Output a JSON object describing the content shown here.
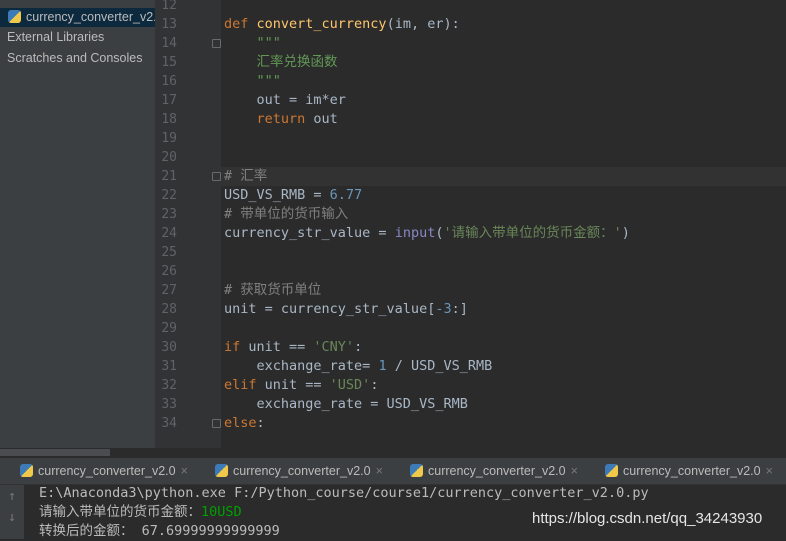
{
  "sidebar": {
    "items": [
      {
        "label": "currency_converter_v2.",
        "icon": "python-file-icon",
        "selected": true
      },
      {
        "label": "External Libraries",
        "icon": "library-icon"
      },
      {
        "label": "Scratches and Consoles",
        "icon": "scratches-icon"
      }
    ]
  },
  "editor": {
    "first_line": 12,
    "current_line": 21,
    "lines": [
      [],
      [
        [
          "def ",
          "kw"
        ],
        [
          "convert_currency",
          "fn"
        ],
        [
          "(im, er):",
          ""
        ]
      ],
      [
        [
          "    \"\"\"",
          "doc"
        ]
      ],
      [
        [
          "    汇率兑换函数",
          "doc"
        ]
      ],
      [
        [
          "    \"\"\"",
          "doc"
        ]
      ],
      [
        [
          "    out = im*er",
          ""
        ]
      ],
      [
        [
          "    ",
          ""
        ],
        [
          "return ",
          "kw"
        ],
        [
          "out",
          ""
        ]
      ],
      [],
      [],
      [
        [
          "# 汇率",
          "cm"
        ]
      ],
      [
        [
          "USD_VS_RMB = ",
          ""
        ],
        [
          "6.77",
          "num"
        ]
      ],
      [
        [
          "# 带单位的货币输入",
          "cm"
        ]
      ],
      [
        [
          "currency_str_value = ",
          ""
        ],
        [
          "input",
          "bi"
        ],
        [
          "(",
          ""
        ],
        [
          "'请输入带单位的货币金额：'",
          "str"
        ],
        [
          ")",
          ""
        ]
      ],
      [],
      [],
      [
        [
          "# 获取货币单位",
          "cm"
        ]
      ],
      [
        [
          "unit = currency_str_value[",
          ""
        ],
        [
          "-3",
          "num"
        ],
        [
          ":]",
          ""
        ]
      ],
      [],
      [
        [
          "if ",
          "kw"
        ],
        [
          "unit == ",
          ""
        ],
        [
          "'CNY'",
          "str"
        ],
        [
          ":",
          ""
        ]
      ],
      [
        [
          "    exchange_rate= ",
          ""
        ],
        [
          "1",
          "num"
        ],
        [
          " / USD_VS_RMB",
          ""
        ]
      ],
      [
        [
          "elif ",
          "kw"
        ],
        [
          "unit == ",
          ""
        ],
        [
          "'USD'",
          "str"
        ],
        [
          ":",
          ""
        ]
      ],
      [
        [
          "    exchange_rate = USD_VS_RMB",
          ""
        ]
      ],
      [
        [
          "else",
          "kw"
        ],
        [
          ":",
          ""
        ]
      ]
    ]
  },
  "tabs": [
    {
      "label": "currency_converter_v2.0"
    },
    {
      "label": "currency_converter_v2.0"
    },
    {
      "label": "currency_converter_v2.0"
    },
    {
      "label": "currency_converter_v2.0"
    }
  ],
  "tab_close": "×",
  "console": {
    "command": "E:\\Anaconda3\\python.exe F:/Python_course/course1/currency_converter_v2.0.py",
    "prompt": "请输入带单位的货币金额：",
    "input_value": "10USD",
    "result": "转换后的金额： 67.69999999999999",
    "up_arrow": "↑",
    "down_arrow": "↓"
  },
  "watermark": "https://blog.csdn.net/qq_34243930",
  "colors": {
    "keyword": "#cc7832",
    "function": "#ffc66d",
    "string": "#6a8759",
    "number": "#6897bb",
    "comment": "#808080",
    "input": "#00a000"
  }
}
